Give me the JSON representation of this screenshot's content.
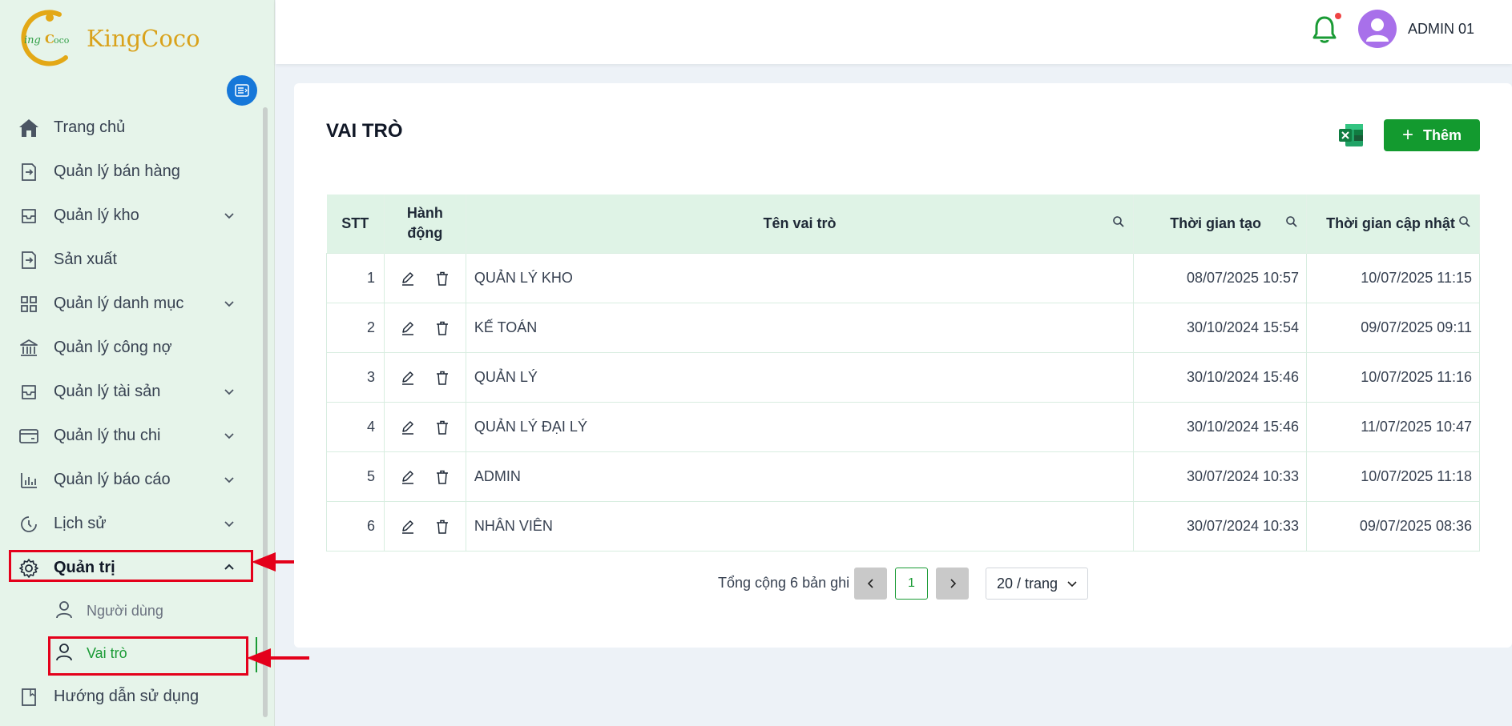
{
  "app": {
    "brand": "KingCoco",
    "brand_mark": "KingCoco"
  },
  "header": {
    "user_name": "ADMIN 01"
  },
  "sidebar": {
    "items": [
      {
        "label": "Trang chủ",
        "icon": "home-icon",
        "expandable": false
      },
      {
        "label": "Quản lý bán hàng",
        "icon": "sales-icon",
        "expandable": false
      },
      {
        "label": "Quản lý kho",
        "icon": "inbox-icon",
        "expandable": true
      },
      {
        "label": "Sản xuất",
        "icon": "production-icon",
        "expandable": false
      },
      {
        "label": "Quản lý danh mục",
        "icon": "grid-icon",
        "expandable": true
      },
      {
        "label": "Quản lý công nợ",
        "icon": "bank-icon",
        "expandable": false
      },
      {
        "label": "Quản lý tài sản",
        "icon": "inbox-icon",
        "expandable": true
      },
      {
        "label": "Quản lý thu chi",
        "icon": "card-icon",
        "expandable": true
      },
      {
        "label": "Quản lý báo cáo",
        "icon": "bar-chart-icon",
        "expandable": true
      },
      {
        "label": "Lịch sử",
        "icon": "history-icon",
        "expandable": true
      },
      {
        "label": "Quản trị",
        "icon": "gear-icon",
        "expandable": true,
        "expanded": true
      }
    ],
    "sub_items": [
      {
        "label": "Người dùng",
        "icon": "user-icon",
        "active": false
      },
      {
        "label": "Vai trò",
        "icon": "user-icon",
        "active": true
      }
    ],
    "footer_item": {
      "label": "Hướng dẫn sử dụng",
      "icon": "book-icon"
    }
  },
  "main": {
    "title": "VAI TRÒ",
    "add_label": "Thêm",
    "table": {
      "headers": {
        "stt": "STT",
        "actions": "Hành động",
        "name": "Tên vai trò",
        "created": "Thời gian tạo",
        "updated": "Thời gian cập nhật"
      },
      "rows": [
        {
          "stt": "1",
          "name": "QUẢN LÝ KHO",
          "created": "08/07/2025 10:57",
          "updated": "10/07/2025 11:15"
        },
        {
          "stt": "2",
          "name": "KẾ TOÁN",
          "created": "30/10/2024 15:54",
          "updated": "09/07/2025 09:11"
        },
        {
          "stt": "3",
          "name": "QUẢN LÝ",
          "created": "30/10/2024 15:46",
          "updated": "10/07/2025 11:16"
        },
        {
          "stt": "4",
          "name": "QUẢN LÝ ĐẠI LÝ",
          "created": "30/10/2024 15:46",
          "updated": "11/07/2025 10:47"
        },
        {
          "stt": "5",
          "name": "ADMIN",
          "created": "30/07/2024 10:33",
          "updated": "10/07/2025 11:18"
        },
        {
          "stt": "6",
          "name": "NHÂN VIÊN",
          "created": "30/07/2024 10:33",
          "updated": "09/07/2025 08:36"
        }
      ]
    },
    "pagination": {
      "total_text": "Tổng cộng 6 bản ghi",
      "prev": "<",
      "current_page": "1",
      "next": ">",
      "page_size": "20 / trang"
    }
  },
  "colors": {
    "accent_green": "#139a2f",
    "sidebar_bg": "#e6f4ea",
    "header_row_bg": "#dff3e6",
    "highlight_red": "#e4001b",
    "collapse_blue": "#1677d9",
    "avatar_purple": "#a870ea"
  }
}
